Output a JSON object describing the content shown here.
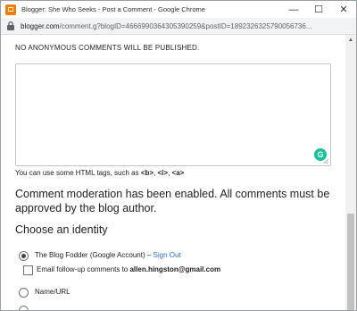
{
  "window": {
    "title": "Blogger: She Who Seeks - Post a Comment - Google Chrome",
    "minimize_glyph": "—",
    "maximize_glyph": "☐",
    "close_glyph": "✕"
  },
  "address_bar": {
    "host": "blogger.com",
    "path": "/comment.g?blogID=4666990364305390259&postID=1892326325790056736..."
  },
  "notice": "NO ANONYMOUS COMMENTS WILL BE PUBLISHED.",
  "comment_box": {
    "value": ""
  },
  "grammarly_letter": "G",
  "html_tip": {
    "prefix": "You can use some HTML tags, such as ",
    "tag_b": "<b>",
    "comma1": ", ",
    "tag_i": "<i>",
    "comma2": ", ",
    "tag_a": "<a>"
  },
  "moderation_text": "Comment moderation has been enabled. All comments must be approved by the blog author.",
  "identity": {
    "heading": "Choose an identity",
    "google_account_label": "The Blog Fodder (Google Account)",
    "separator": " – ",
    "sign_out_label": "Sign Out",
    "email_follow_prefix": "Email follow-up comments to ",
    "email_address": "allen.hingston@gmail.com",
    "name_url_label": "Name/URL"
  },
  "colors": {
    "link": "#2a6fdb",
    "grammarly": "#15c39a",
    "blogger_orange": "#f57d00"
  }
}
